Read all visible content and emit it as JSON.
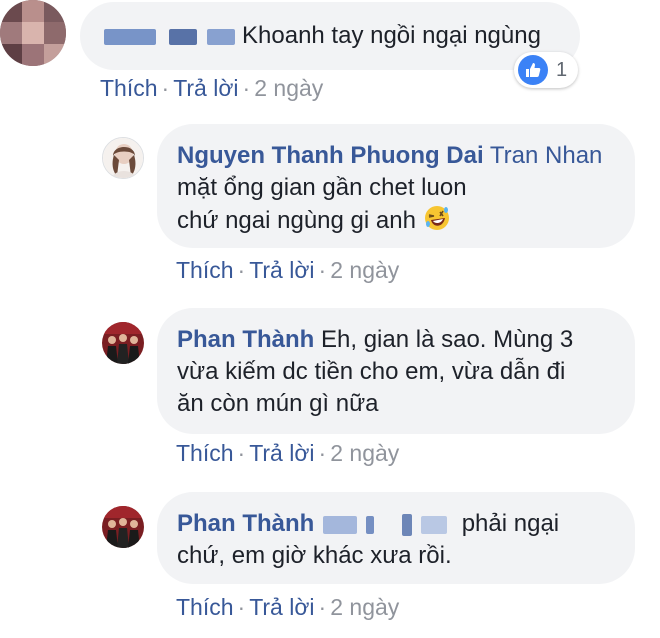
{
  "comments": [
    {
      "author": "",
      "text": "Khoanh tay ngồi ngại ngùng",
      "actions": {
        "like": "Thích",
        "reply": "Trả lời",
        "time": "2 ngày"
      },
      "reaction": {
        "icon": "thumbs-up-icon",
        "count": "1"
      }
    },
    {
      "author": "Nguyen Thanh Phuong Dai",
      "mention": "Tran Nhan",
      "text_line1": "mặt ổng gian gần chet luon",
      "text_line2": "chứ ngai ngùng gi anh",
      "emoji": "rolling-laughing-emoji",
      "actions": {
        "like": "Thích",
        "reply": "Trả lời",
        "time": "2 ngày"
      }
    },
    {
      "author": "Phan Thành",
      "text_line1": "Eh, gian là sao. Mùng 3",
      "text_line2": "vừa kiếm dc tiền cho em, vừa dẫn đi",
      "text_line3": "ăn còn mún gì nữa",
      "actions": {
        "like": "Thích",
        "reply": "Trả lời",
        "time": "2 ngày"
      }
    },
    {
      "author": "Phan Thành",
      "text_line1": "phải ngại",
      "text_line2": "chứ, em giờ khác xưa rồi.",
      "actions": {
        "like": "Thích",
        "reply": "Trả lời",
        "time": "2 ngày"
      }
    }
  ],
  "colors": {
    "link": "#385898",
    "bubble": "#f2f3f5",
    "like_blue": "#3b82f6",
    "meta": "#90949c"
  }
}
